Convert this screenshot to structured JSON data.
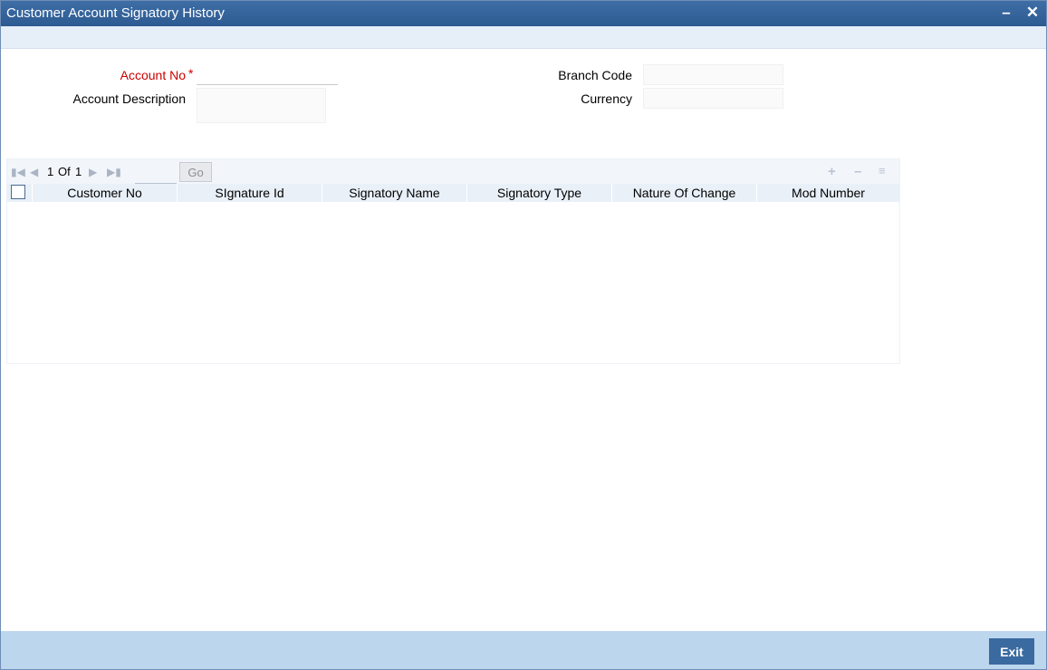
{
  "window": {
    "title": "Customer Account Signatory History"
  },
  "form": {
    "account_no_label": "Account No",
    "account_no_required": "*",
    "account_no_value": "",
    "account_description_label": "Account Description",
    "account_description_value": "",
    "branch_code_label": "Branch Code",
    "branch_code_value": "",
    "currency_label": "Currency",
    "currency_value": ""
  },
  "grid": {
    "pager": {
      "current": "1",
      "of_label": "Of",
      "total": "1",
      "page_input": "",
      "go_label": "Go"
    },
    "columns": [
      "Customer No",
      "SIgnature Id",
      "Signatory Name",
      "Signatory Type",
      "Nature Of Change",
      "Mod Number"
    ],
    "rows": []
  },
  "footer": {
    "exit_label": "Exit"
  },
  "icons": {
    "first": "first-page-icon",
    "prev": "prev-page-icon",
    "next": "next-page-icon",
    "last": "last-page-icon",
    "add": "add-row-icon",
    "remove": "remove-row-icon",
    "view": "single-view-icon"
  },
  "colors": {
    "titlebar": "#2c5a91",
    "required": "#cc0000",
    "footer": "#bcd6ee",
    "exit_button": "#3b6aa0"
  }
}
